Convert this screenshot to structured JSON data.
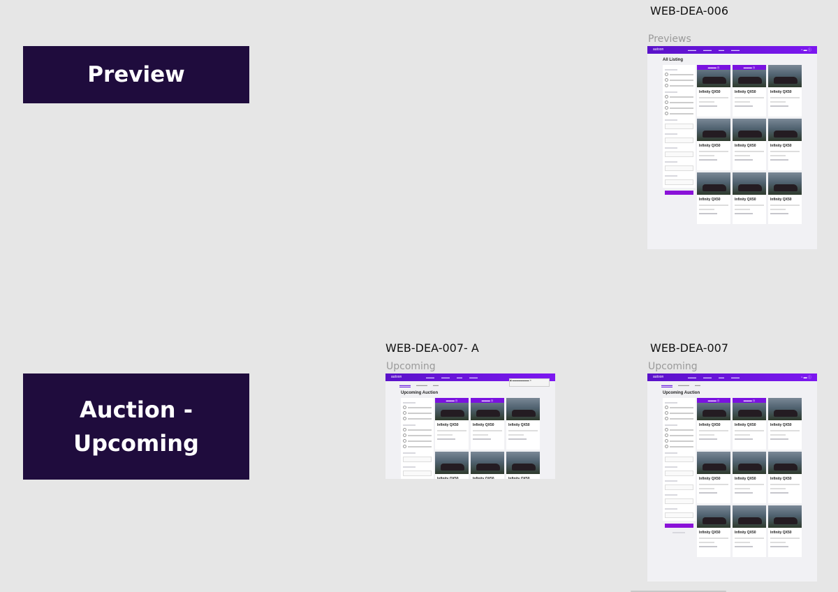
{
  "sections": {
    "preview": "Preview",
    "auction_line1": "Auction -",
    "auction_line2": "Upcoming"
  },
  "frames": {
    "f006": {
      "title": "WEB-DEA-006",
      "subtitle": "Previews"
    },
    "f007a": {
      "title": "WEB-DEA-007- A",
      "subtitle": "Upcoming"
    },
    "f007": {
      "title": "WEB-DEA-007",
      "subtitle": "Upcoming"
    }
  },
  "mockup": {
    "logo": "autoon",
    "heading_all": "All Listing",
    "heading_upcoming": "Upcoming Auction",
    "car_name": "Infinity QX50"
  }
}
